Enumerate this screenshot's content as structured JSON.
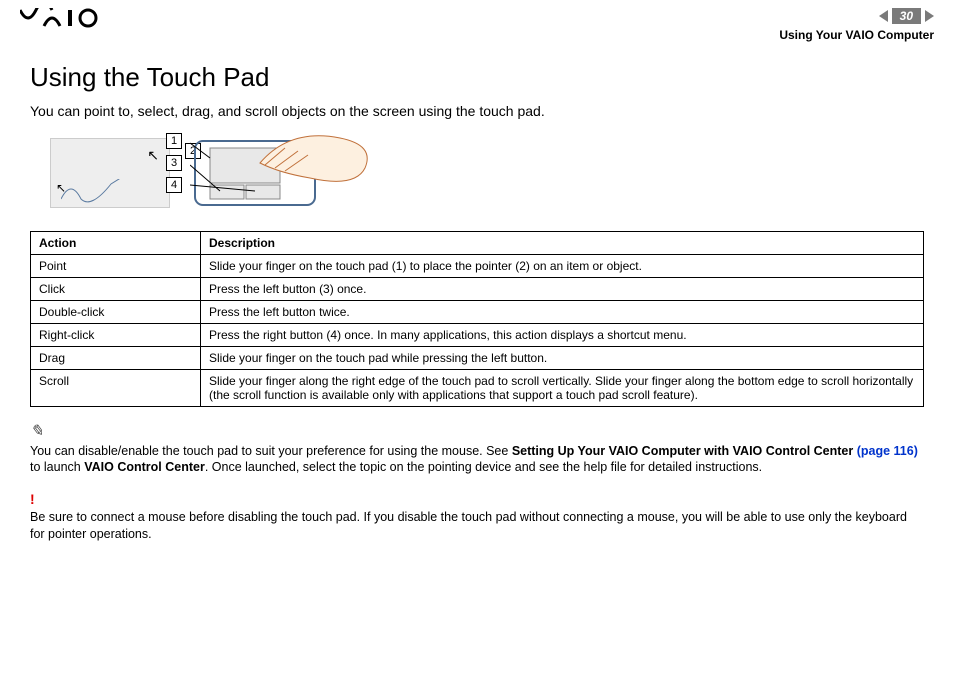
{
  "header": {
    "page_number": "30",
    "breadcrumb": "Using Your VAIO Computer"
  },
  "title": "Using the Touch Pad",
  "intro": "You can point to, select, drag, and scroll objects on the screen using the touch pad.",
  "callouts": {
    "c1": "1",
    "c2": "2",
    "c3": "3",
    "c4": "4"
  },
  "table": {
    "headers": {
      "action": "Action",
      "description": "Description"
    },
    "rows": [
      {
        "action": "Point",
        "description": "Slide your finger on the touch pad (1) to place the pointer (2) on an item or object."
      },
      {
        "action": "Click",
        "description": "Press the left button (3) once."
      },
      {
        "action": "Double-click",
        "description": "Press the left button twice."
      },
      {
        "action": "Right-click",
        "description": "Press the right button (4) once. In many applications, this action displays a shortcut menu."
      },
      {
        "action": "Drag",
        "description": "Slide your finger on the touch pad while pressing the left button."
      },
      {
        "action": "Scroll",
        "description": "Slide your finger along the right edge of the touch pad to scroll vertically. Slide your finger along the bottom edge to scroll horizontally (the scroll function is available only with applications that support a touch pad scroll feature)."
      }
    ]
  },
  "note": {
    "pre": "You can disable/enable the touch pad to suit your preference for using the mouse. See ",
    "link_label": "Setting Up Your VAIO Computer with VAIO Control Center",
    "page_ref": "(page 116)",
    "mid": " to launch ",
    "bold_app": "VAIO Control Center",
    "post": ". Once launched, select the topic on the pointing device and see the help file for detailed instructions."
  },
  "warning": {
    "icon": "!",
    "text": "Be sure to connect a mouse before disabling the touch pad. If you disable the touch pad without connecting a mouse, you will be able to use only the keyboard for pointer operations."
  }
}
